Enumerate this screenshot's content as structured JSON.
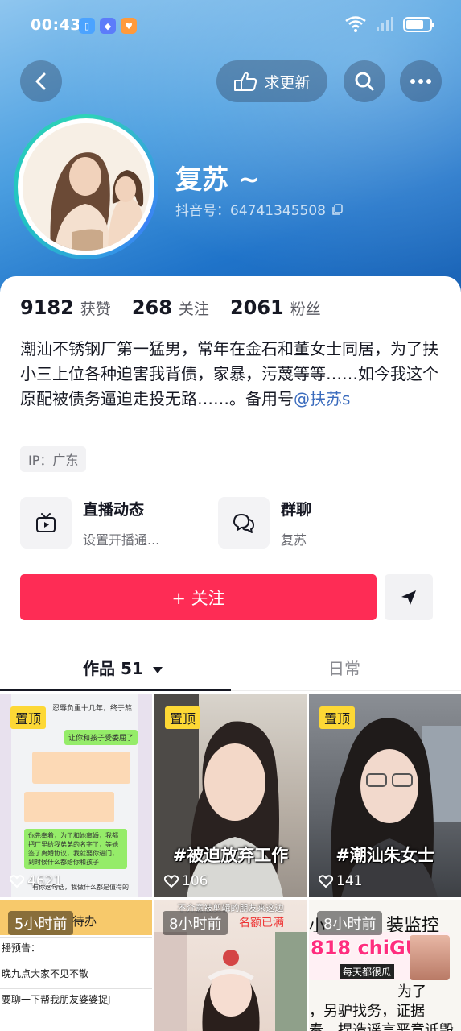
{
  "status_bar": {
    "time": "00:43",
    "apps": [
      "book",
      "shield",
      "heart"
    ],
    "battery_level": 0.75
  },
  "nav": {
    "request_update_label": "求更新"
  },
  "profile": {
    "nickname": "复苏 ~",
    "douyin_id": "抖音号：64741345508",
    "stats": [
      {
        "value": "9182",
        "label": "获赞"
      },
      {
        "value": "268",
        "label": "关注"
      },
      {
        "value": "2061",
        "label": "粉丝"
      }
    ],
    "bio_text": "潮汕不锈钢厂第一猛男，常年在金石和董女士同居，为了扶小三上位各种迫害我背债，家暴，污蔑等等……如今我这个原配被债务逼迫走投无路……。备用号",
    "bio_link": "@扶苏s",
    "ip": "IP：广东"
  },
  "features": [
    {
      "title": "直播动态",
      "subtitle": "设置开播通..."
    },
    {
      "title": "群聊",
      "subtitle": "复苏"
    }
  ],
  "actions": {
    "follow_label": "+ 关注"
  },
  "tabs": {
    "works_label": "作品 51",
    "daily_label": "日常"
  },
  "posts": [
    {
      "pinned": "置顶",
      "likes": "4621",
      "chat": {
        "header": "忍辱负重十几年，终于熬",
        "q": "让你和孩子受委屈了",
        "a": "你先奉着，为了和她离婚，我都把厂里给我弟弟的名字了，等她签了离婚协议，我就娶你进门，到时候什么都给你和孩子",
        "footer": "有你这句话，我做什么都是值得的"
      }
    },
    {
      "pinned": "置顶",
      "likes": "106",
      "caption": "#被迫放弃工作"
    },
    {
      "pinned": "置顶",
      "likes": "141",
      "caption": "#潮汕朱女士"
    },
    {
      "time": "5小时前",
      "todo_title": "待办",
      "todo_items": [
        "播预告：",
        "晚九点大家不见不散",
        "要聊一下帮我朋友婆婆捉J"
      ]
    },
    {
      "time": "8小时前",
      "overlay_text": "不介意被剪辑的朋友来这边",
      "overlay_text2": "名额已满"
    },
    {
      "time": "8小时前",
      "overlay_prefix": "小",
      "overlay_text": "装监控",
      "ad_brand": "818 chiGUA",
      "ad_slogan": "每天都很瓜",
      "bottom_text1": "为了",
      "bottom_text2": "，另驴找务，证据",
      "bottom_text3": "奏，捏造谣言恶意诋毁"
    }
  ]
}
